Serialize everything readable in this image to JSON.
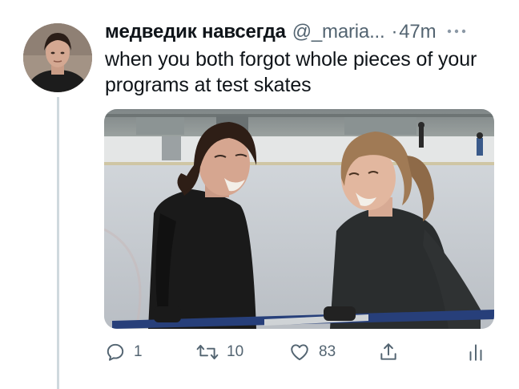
{
  "tweet": {
    "display_name": "медведик навсегда",
    "handle": "@_maria...",
    "separator": "·",
    "time": "47m",
    "more_icon": "more-dots-icon",
    "text": "when you both forgot whole pieces of your programs at test skates"
  },
  "media": {
    "description_icon": "photo"
  },
  "actions": {
    "reply_count": "1",
    "retweet_count": "10",
    "like_count": "83",
    "icons": [
      "reply-icon",
      "retweet-icon",
      "like-icon",
      "share-icon",
      "analytics-icon"
    ]
  },
  "colors": {
    "text_primary": "#0f1419",
    "text_secondary": "#536471",
    "thread_line": "#cfd9de"
  }
}
